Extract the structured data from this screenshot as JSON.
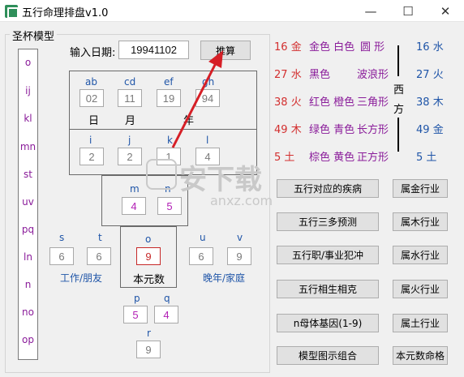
{
  "window": {
    "title": "五行命理排盘v1.0",
    "controls": {
      "minimize": "—",
      "maximize": "☐",
      "close": "✕"
    }
  },
  "group": {
    "label": "圣杯模型"
  },
  "left_column": [
    "o",
    "ij",
    "kl",
    "mn",
    "st",
    "uv",
    "pq",
    "ln",
    "n",
    "no",
    "op"
  ],
  "input": {
    "label": "输入日期:",
    "value": "19941102",
    "button": "推算"
  },
  "grid": {
    "row1_labels": [
      "ab",
      "cd",
      "ef",
      "gh"
    ],
    "row1_values": [
      "02",
      "11",
      "19",
      "94"
    ],
    "date_labels": [
      "日",
      "月",
      "年"
    ],
    "row2_labels": [
      "i",
      "j",
      "k",
      "l"
    ],
    "row2_values": [
      "2",
      "2",
      "1",
      "4"
    ],
    "mn_labels": [
      "m",
      "n"
    ],
    "mn_values": [
      "4",
      "5"
    ],
    "s_label": "s",
    "t_label": "t",
    "s_value": "6",
    "t_value": "6",
    "o_label": "o",
    "o_value": "9",
    "u_label": "u",
    "v_label": "v",
    "u_value": "6",
    "v_value": "9",
    "work_label": "工作/朋友",
    "core_label": "本元数",
    "late_label": "晚年/家庭",
    "p_label": "p",
    "q_label": "q",
    "p_value": "5",
    "q_value": "4",
    "r_label": "r",
    "r_value": "9"
  },
  "west": {
    "rows": [
      {
        "num": "16",
        "elem": "金",
        "color": "金色 白色",
        "shape": "圆 形"
      },
      {
        "num": "27",
        "elem": "水",
        "color": "黑色",
        "shape": "波浪形"
      },
      {
        "num": "38",
        "elem": "火",
        "color": "红色 橙色",
        "shape": "三角形"
      },
      {
        "num": "49",
        "elem": "木",
        "color": "绿色 青色",
        "shape": "长方形"
      },
      {
        "num": "5",
        "elem": "土",
        "color": "棕色 黄色",
        "shape": "正方形"
      }
    ],
    "side_label_1": "西",
    "side_label_2": "方",
    "right_rows": [
      {
        "num": "16",
        "elem": "水"
      },
      {
        "num": "27",
        "elem": "火"
      },
      {
        "num": "38",
        "elem": "木"
      },
      {
        "num": "49",
        "elem": "金"
      },
      {
        "num": "5",
        "elem": "土"
      }
    ]
  },
  "buttons_left": [
    "五行对应的疾病",
    "五行三多预测",
    "五行职/事业犯冲",
    "五行相生相克",
    "n母体基因(1-9)",
    "模型图示组合"
  ],
  "buttons_right": [
    "属金行业",
    "属木行业",
    "属水行业",
    "属火行业",
    "属土行业",
    "本元数命格"
  ],
  "watermark": {
    "text": "安下载",
    "sub": "anxz.com"
  }
}
